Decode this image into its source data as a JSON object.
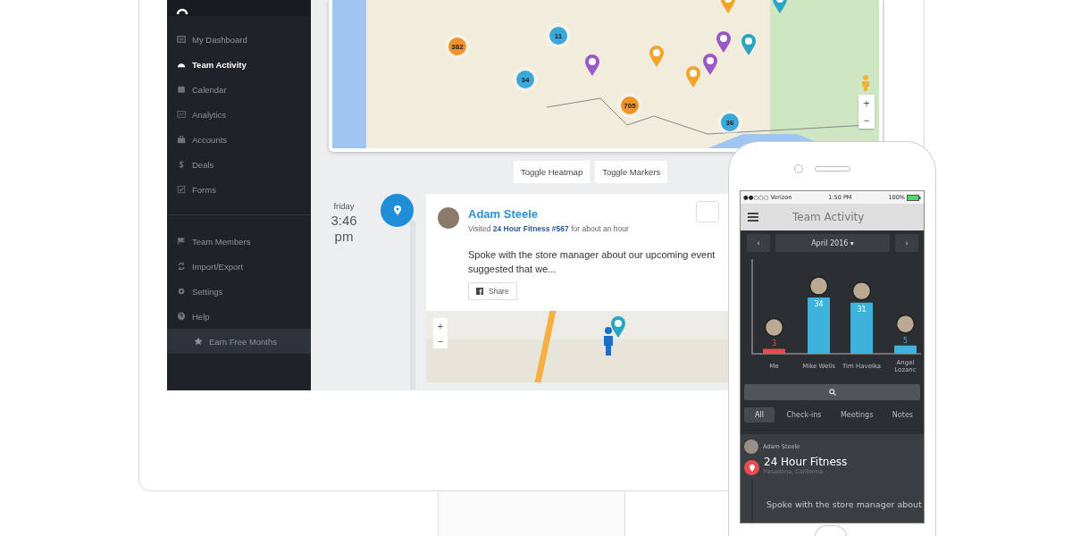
{
  "desktop": {
    "sidebar": {
      "items": [
        {
          "label": "My Dashboard",
          "selected": false
        },
        {
          "label": "Team Activity",
          "selected": true
        },
        {
          "label": "Calendar",
          "selected": false
        },
        {
          "label": "Analytics",
          "selected": false
        },
        {
          "label": "Accounts",
          "selected": false
        },
        {
          "label": "Deals",
          "selected": false
        },
        {
          "label": "Forms",
          "selected": false
        }
      ],
      "footer_items": [
        {
          "label": "Team Members",
          "selected": false
        },
        {
          "label": "Import/Export",
          "selected": false
        },
        {
          "label": "Settings",
          "selected": false
        },
        {
          "label": "Help",
          "selected": false
        }
      ],
      "promo": {
        "label": "Earn Free Months"
      }
    },
    "map": {
      "clusters": [
        {
          "count": "382",
          "color": "#f0932b"
        },
        {
          "count": "11",
          "color": "#3aa8d8"
        },
        {
          "count": "34",
          "color": "#3aa8d8"
        },
        {
          "count": "705",
          "color": "#f0932b"
        },
        {
          "count": "36",
          "color": "#3aa8d8"
        }
      ],
      "markers": [
        {
          "color": "#9b59c6"
        },
        {
          "color": "#f0a52b"
        },
        {
          "color": "#f0a52b"
        },
        {
          "color": "#9b59c6"
        },
        {
          "color": "#9b59c6"
        },
        {
          "color": "#2aa6c4"
        },
        {
          "color": "#2aa6c4"
        },
        {
          "color": "#f0a52b"
        }
      ],
      "zoom_in": "+",
      "zoom_out": "−"
    },
    "map_buttons": [
      "Toggle Heatmap",
      "Toggle Markers"
    ],
    "timeline": {
      "day": "friday",
      "time": "3:46",
      "meridiem": "pm"
    },
    "activity": {
      "name": "Adam Steele",
      "summary": "Visited **24 Hour Fitness #567** for about an hour",
      "note": "Spoke with the store manager about our upcoming event suggested that we...",
      "share": "Share",
      "map": {
        "zoom_in": "+",
        "zoom_out": "−"
      }
    }
  },
  "phone": {
    "status": {
      "carrier": "●●○○○ Verizon",
      "time": "1:50 PM",
      "battery": "100%"
    },
    "title": "Team Activity",
    "month": {
      "prev": "‹",
      "label": "April 2016 ▾",
      "next": "›"
    },
    "chart_data": {
      "type": "bar",
      "categories": [
        "Me",
        "Mike Wells",
        "Tim Havelka",
        "Angel Lozanc"
      ],
      "series": [
        {
          "color": "#e84c4f",
          "values": [
            3,
            null,
            null,
            null
          ]
        },
        {
          "color": "#3bb3dc",
          "values": [
            null,
            34,
            31,
            5
          ]
        }
      ],
      "stacked": true,
      "data_labels": true
    },
    "filters": [
      {
        "label": "All",
        "selected": true
      },
      {
        "label": "Check-ins",
        "selected": false
      },
      {
        "label": "Meetings",
        "selected": false
      },
      {
        "label": "Notes",
        "selected": false
      }
    ],
    "feed": {
      "name": "Adam Steele",
      "place": "24 Hour Fitness",
      "location": "Pasadena, California",
      "note": "Spoke with the store manager about"
    }
  }
}
